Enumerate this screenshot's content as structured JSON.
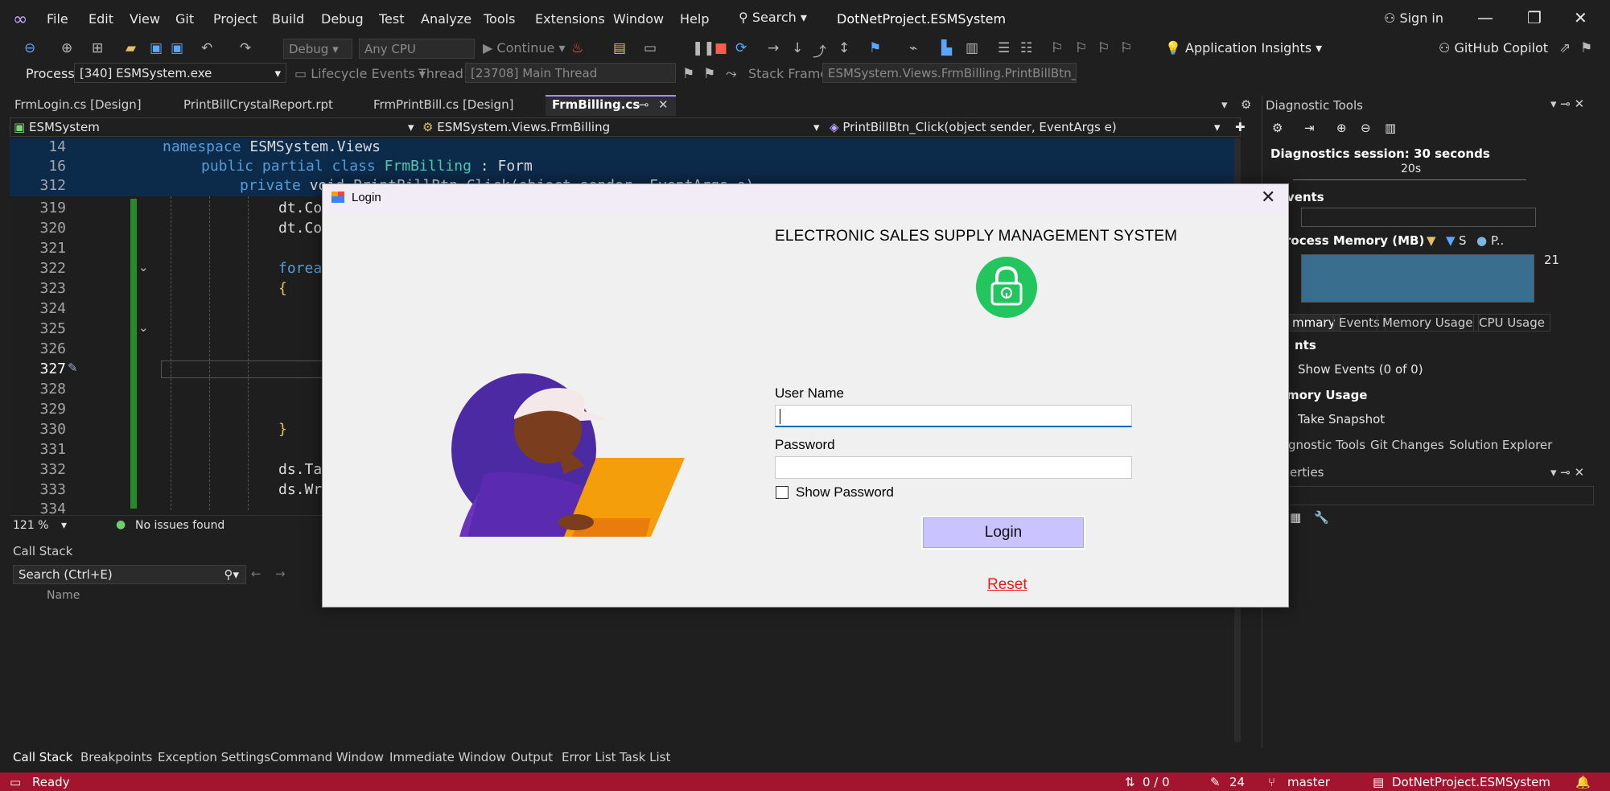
{
  "menu": [
    "File",
    "Edit",
    "View",
    "Git",
    "Project",
    "Build",
    "Debug",
    "Test",
    "Analyze",
    "Tools",
    "Extensions",
    "Window",
    "Help"
  ],
  "search_label": "Search",
  "solution_name": "DotNetProject.ESMSystem",
  "sign_in": "Sign in",
  "toolbar": {
    "config": "Debug",
    "platform": "Any CPU",
    "continue": "Continue",
    "app_insights": "Application Insights",
    "copilot": "GitHub Copilot"
  },
  "debug_bar": {
    "process_label": "Process:",
    "process_value": "[340] ESMSystem.exe",
    "lifecycle": "Lifecycle Events",
    "thread_label": "Thread:",
    "thread_value": "[23708] Main Thread",
    "stack_frame_label": "Stack Frame:",
    "stack_frame_value": "ESMSystem.Views.FrmBilling.PrintBillBtn_C"
  },
  "doc_tabs": [
    "FrmLogin.cs [Design]",
    "PrintBillCrystalReport.rpt",
    "FrmPrintBill.cs [Design]",
    "FrmBilling.cs"
  ],
  "nav": {
    "project": "ESMSystem",
    "class": "ESMSystem.Views.FrmBilling",
    "member": "PrintBillBtn_Click(object sender, EventArgs e)"
  },
  "code_sticky": [
    {
      "num": "14",
      "kw": "namespace",
      "rest": " ESMSystem.Views"
    },
    {
      "num": "16",
      "kw": "public partial class",
      "ty": " FrmBilling",
      "rest": " : Form"
    },
    {
      "num": "312",
      "kw": "private",
      "rest": " void PrintBillBtn_Click(object sender, EventArgs e)"
    }
  ],
  "code_lines": [
    {
      "num": "319",
      "text": "dt.Co"
    },
    {
      "num": "320",
      "text": "dt.Co"
    },
    {
      "num": "321",
      "text": ""
    },
    {
      "num": "322",
      "text": "forea"
    },
    {
      "num": "323",
      "text": "{"
    },
    {
      "num": "324",
      "text": ""
    },
    {
      "num": "325",
      "text": ""
    },
    {
      "num": "326",
      "text": ""
    },
    {
      "num": "327",
      "text": ""
    },
    {
      "num": "328",
      "text": ""
    },
    {
      "num": "329",
      "text": ""
    },
    {
      "num": "330",
      "text": "}"
    },
    {
      "num": "331",
      "text": ""
    },
    {
      "num": "332",
      "text": "ds.Ta"
    },
    {
      "num": "333",
      "text": "ds.Wr"
    },
    {
      "num": "334",
      "text": ""
    }
  ],
  "editor_status": {
    "zoom": "121 %",
    "issues": "No issues found"
  },
  "callstack": {
    "title": "Call Stack",
    "search_placeholder": "Search (Ctrl+E)",
    "col_name": "Name"
  },
  "bottom_tabs": [
    "Call Stack",
    "Breakpoints",
    "Exception Settings",
    "Command Window",
    "Immediate Window",
    "Output",
    "Error List",
    "Task List"
  ],
  "diagnostics": {
    "title": "Diagnostic Tools",
    "session": "Diagnostics session: 30 seconds",
    "tick_20s": "20s",
    "events_header": "vents",
    "memory_header": "rocess Memory (MB)",
    "legend": "S",
    "legend2": "P..",
    "mem_value": "21",
    "tabs": [
      "mmary",
      "Events",
      "Memory Usage",
      "CPU Usage"
    ],
    "events_section": "nts",
    "show_events": "Show Events (0 of 0)",
    "memory_section": "mory Usage",
    "take_snapshot": "Take Snapshot",
    "panel_tabs": [
      "gnostic Tools",
      "Git Changes",
      "Solution Explorer"
    ],
    "properties": "erties"
  },
  "statusbar": {
    "ready": "Ready",
    "updown": "0 / 0",
    "pencil": "24",
    "branch": "master",
    "project": "DotNetProject.ESMSystem"
  },
  "login": {
    "window_title": "Login",
    "heading": "ELECTRONIC SALES SUPPLY MANAGEMENT SYSTEM",
    "username_label": "User Name",
    "username_value": "",
    "password_label": "Password",
    "password_value": "",
    "show_password": "Show Password",
    "login_button": "Login",
    "reset_link": "Reset",
    "lock_color": "#22c55e",
    "button_color": "#c9c3ff",
    "reset_color": "#e51d1d"
  }
}
